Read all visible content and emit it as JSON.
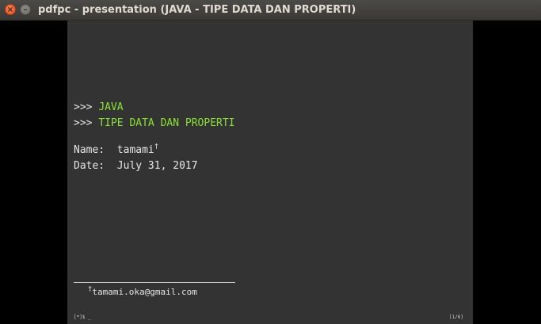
{
  "window": {
    "title": "pdfpc - presentation (JAVA - TIPE DATA DAN PROPERTI)",
    "close_glyph": "×",
    "minimize_glyph": "–"
  },
  "slide": {
    "prompt": ">>> ",
    "heading_1": "JAVA",
    "heading_2": "TIPE DATA DAN PROPERTI",
    "name_label": "Name:  ",
    "name_value": "tamami",
    "footnote_mark": "†",
    "date_label": "Date:  ",
    "date_value": "July 31, 2017",
    "footnote_text": "tamami.oka@gmail.com",
    "status_left": "[*]$ _",
    "status_right": "[1/6]"
  },
  "colors": {
    "heading": "#8ae234",
    "slide_background": "#333333",
    "text": "#e6e6e6"
  }
}
